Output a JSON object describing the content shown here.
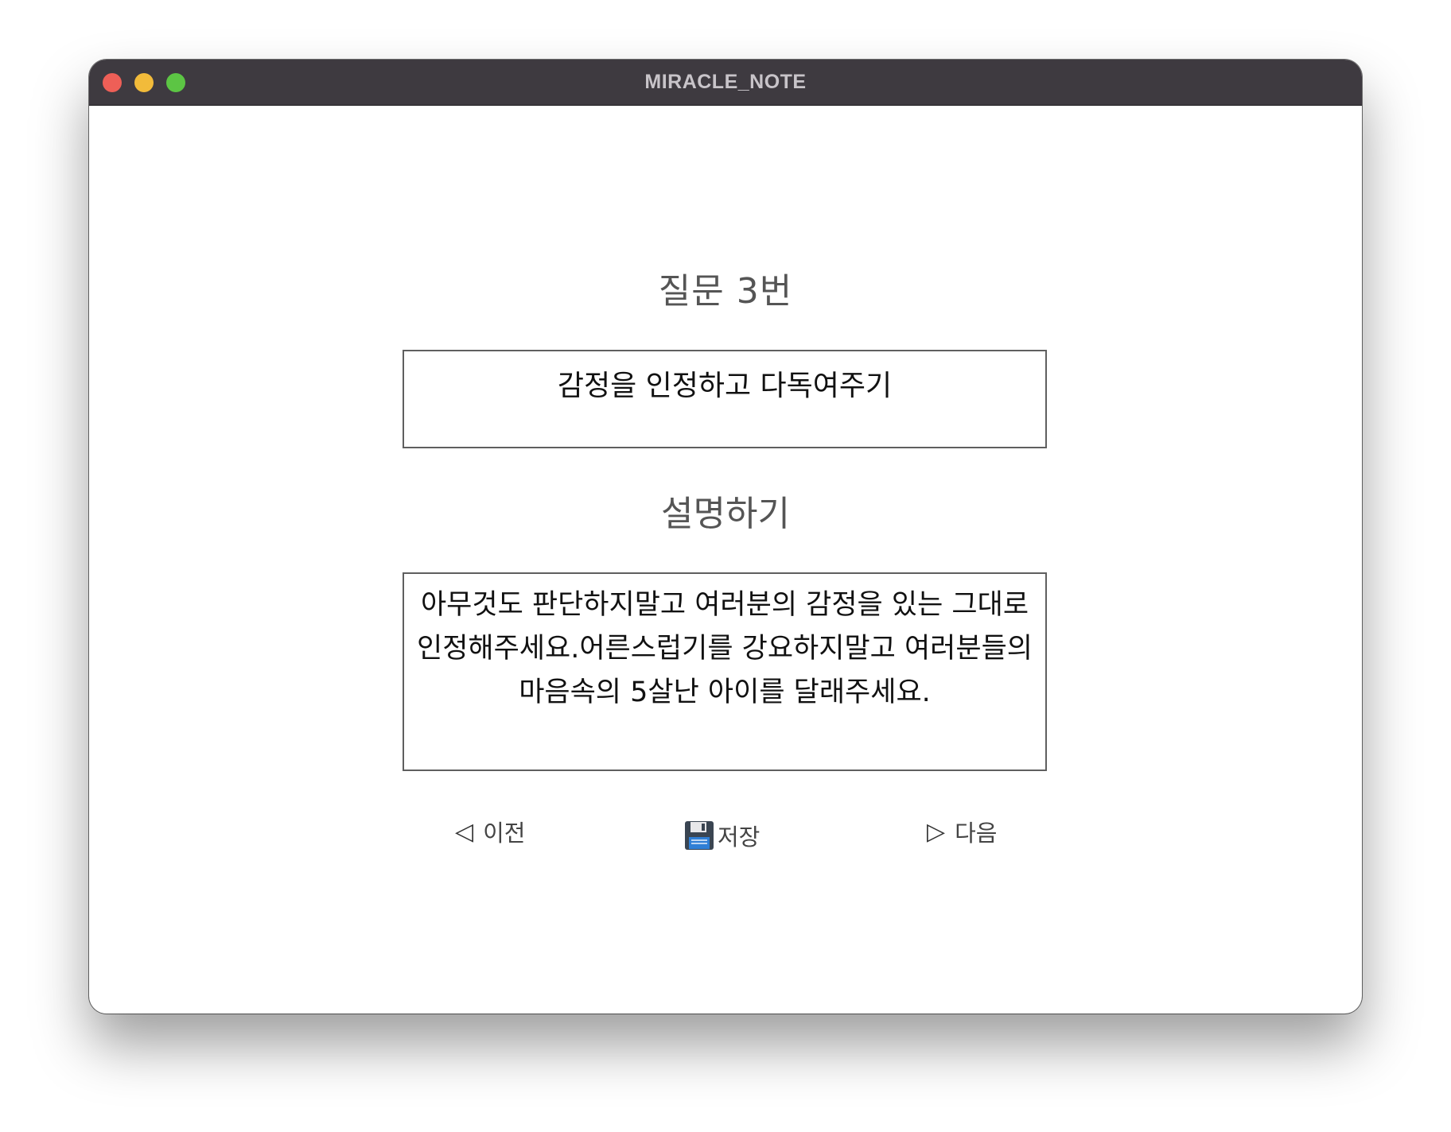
{
  "window": {
    "title": "MIRACLE_NOTE"
  },
  "question": {
    "heading": "질문 3번",
    "text": "감정을 인정하고 다독여주기"
  },
  "description": {
    "heading": "설명하기",
    "text": "아무것도 판단하지말고 여러분의 감정을 있는 그대로 인정해주세요.어른스럽기를 강요하지말고 여러분들의 마음속의 5살난 아이를 달래주세요."
  },
  "nav": {
    "prev_label": "이전",
    "save_label": "저장",
    "next_label": "다음",
    "prev_icon": "◁",
    "next_icon": "▷"
  }
}
